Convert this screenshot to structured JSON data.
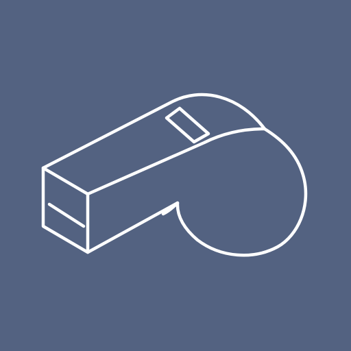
{
  "colors": {
    "background": "#536281",
    "stroke": "#ffffff"
  },
  "icon": {
    "name": "whistle-icon"
  }
}
